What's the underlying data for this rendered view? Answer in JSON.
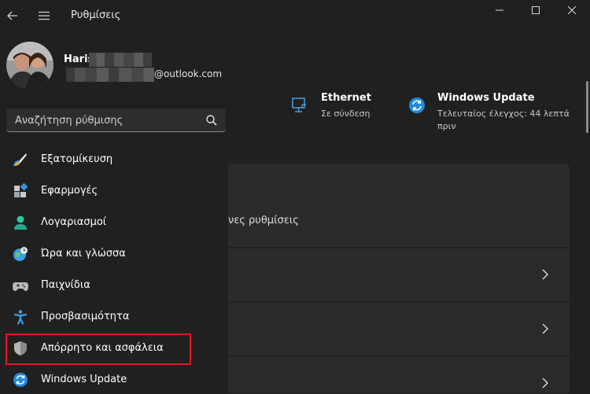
{
  "window": {
    "title": "Ρυθμίσεις"
  },
  "profile": {
    "name": "Haris",
    "email_domain": "@outlook.com"
  },
  "search": {
    "placeholder": "Αναζήτηση ρύθμισης"
  },
  "nav": {
    "items": [
      {
        "label": "Εξατομίκευση",
        "icon": "brush-icon"
      },
      {
        "label": "Εφαρμογές",
        "icon": "apps-icon"
      },
      {
        "label": "Λογαριασμοί",
        "icon": "person-icon"
      },
      {
        "label": "Ώρα και γλώσσα",
        "icon": "clock-globe-icon"
      },
      {
        "label": "Παιχνίδια",
        "icon": "gamepad-icon"
      },
      {
        "label": "Προσβασιμότητα",
        "icon": "accessibility-icon"
      },
      {
        "label": "Απόρρητο και ασφάλεια",
        "icon": "shield-icon"
      },
      {
        "label": "Windows Update",
        "icon": "update-icon"
      }
    ],
    "highlighted_index": 6
  },
  "status": {
    "ethernet": {
      "title": "Ethernet",
      "subtitle": "Σε σύνδεση"
    },
    "windows_update": {
      "title": "Windows Update",
      "subtitle_line1": "Τελευταίος έλεγχος: 44 λεπτά",
      "subtitle_line2": "πριν"
    }
  },
  "content": {
    "card_text": "νες ρυθμίσεις"
  },
  "colors": {
    "background": "#202020",
    "card": "#2b2b2b",
    "accent": "#0078d4",
    "highlight_border": "#e81123"
  }
}
